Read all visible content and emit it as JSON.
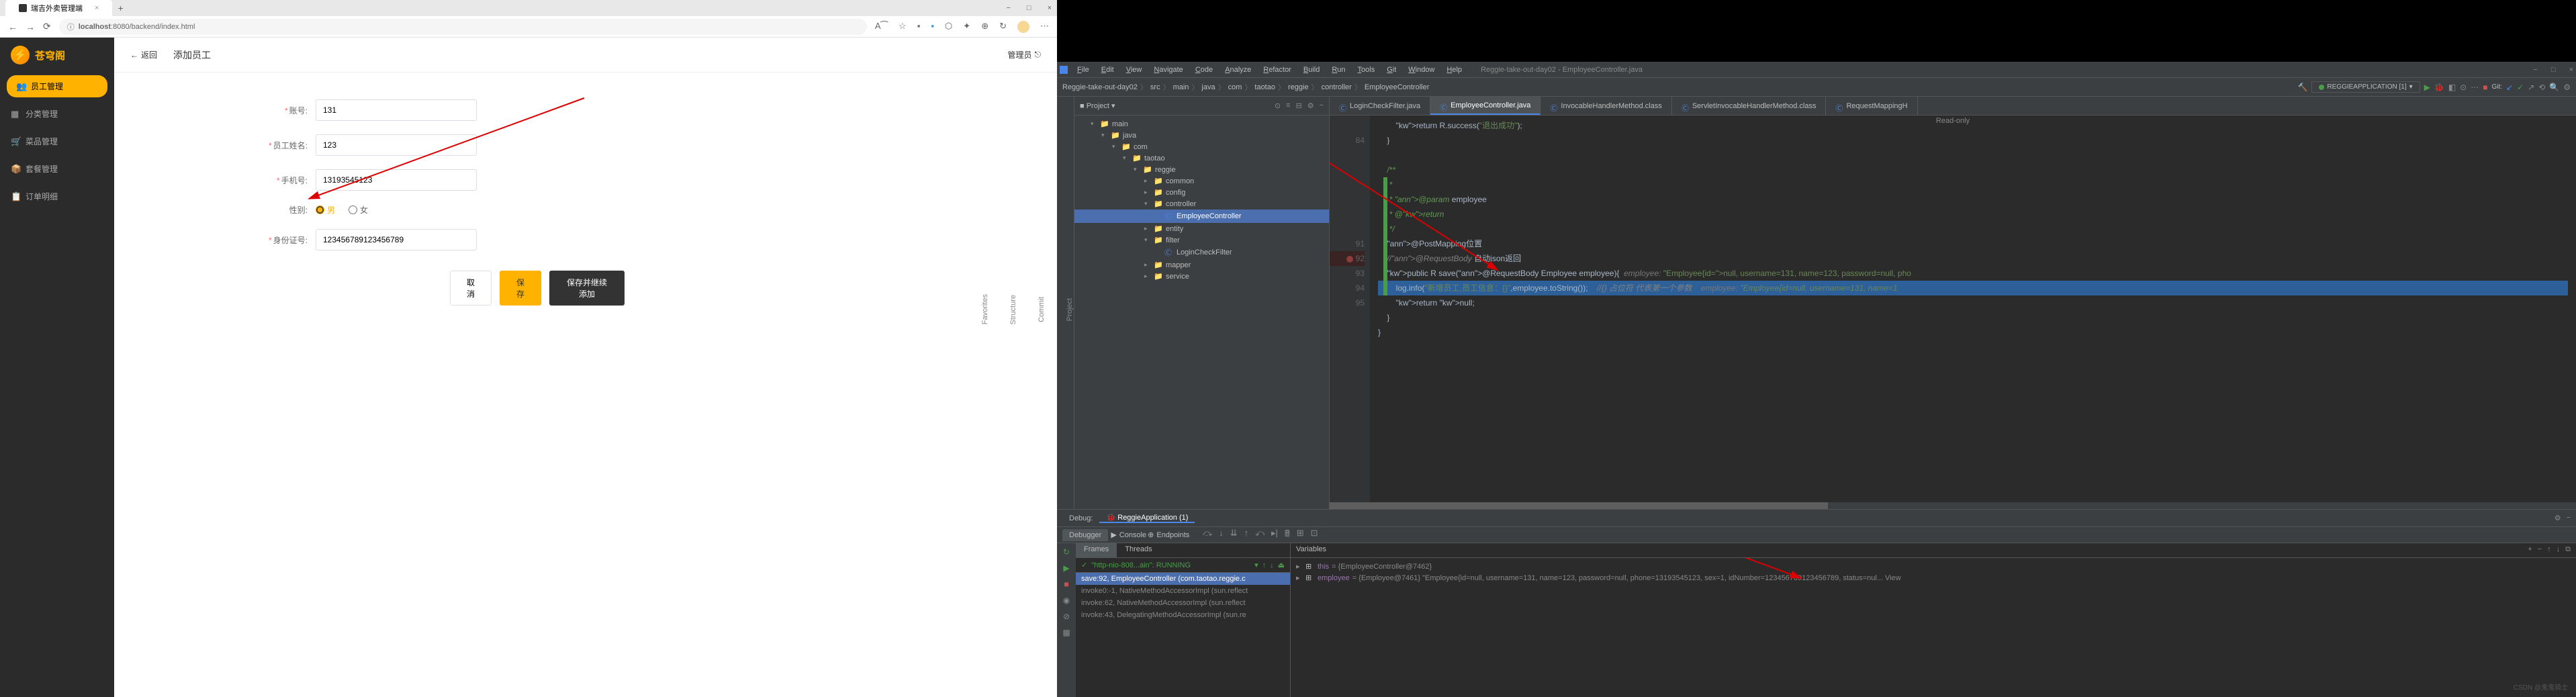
{
  "browser": {
    "tab_title": "瑞吉外卖管理端",
    "url_prefix": "localhost",
    "url": ":8080/backend/index.html",
    "window_controls": [
      "−",
      "□",
      "×"
    ]
  },
  "app": {
    "logo_text": "苍穹阁",
    "sidebar": [
      {
        "icon": "👥",
        "label": "员工管理",
        "active": true
      },
      {
        "icon": "▦",
        "label": "分类管理"
      },
      {
        "icon": "🛒",
        "label": "菜品管理"
      },
      {
        "icon": "📦",
        "label": "套餐管理"
      },
      {
        "icon": "📋",
        "label": "订单明细"
      }
    ],
    "back": "返回",
    "page_title": "添加员工",
    "header_user": "管理员",
    "form": {
      "account_label": "账号:",
      "account_value": "131",
      "name_label": "员工姓名:",
      "name_value": "123",
      "phone_label": "手机号:",
      "phone_value": "13193545123",
      "sex_label": "性别:",
      "sex_male": "男",
      "sex_female": "女",
      "id_label": "身份证号:",
      "id_value": "123456789123456789",
      "btn_cancel": "取消",
      "btn_save": "保存",
      "btn_save_continue": "保存并继续添加"
    }
  },
  "ide": {
    "menus": [
      "File",
      "Edit",
      "View",
      "Navigate",
      "Code",
      "Analyze",
      "Refactor",
      "Build",
      "Run",
      "Tools",
      "Git",
      "Window",
      "Help"
    ],
    "window_title": "Reggie-take-out-day02 - EmployeeController.java",
    "breadcrumb": [
      "Reggie-take-out-day02",
      "src",
      "main",
      "java",
      "com",
      "taotao",
      "reggie",
      "controller",
      "EmployeeController"
    ],
    "run_config": "REGGIEAPPLICATION [1]",
    "git_label": "Git:",
    "project_panel_title": "Project",
    "tree": [
      {
        "indent": 1,
        "arrow": "▾",
        "icon": "📁",
        "label": "main"
      },
      {
        "indent": 2,
        "arrow": "▾",
        "icon": "📁",
        "label": "java"
      },
      {
        "indent": 3,
        "arrow": "▾",
        "icon": "📁",
        "label": "com"
      },
      {
        "indent": 4,
        "arrow": "▾",
        "icon": "📁",
        "label": "taotao"
      },
      {
        "indent": 5,
        "arrow": "▾",
        "icon": "📁",
        "label": "reggie"
      },
      {
        "indent": 6,
        "arrow": "▸",
        "icon": "📁",
        "label": "common"
      },
      {
        "indent": 6,
        "arrow": "▸",
        "icon": "📁",
        "label": "config"
      },
      {
        "indent": 6,
        "arrow": "▾",
        "icon": "📁",
        "label": "controller"
      },
      {
        "indent": 7,
        "arrow": "",
        "icon": "Ⓒ",
        "label": "EmployeeController",
        "selected": true
      },
      {
        "indent": 6,
        "arrow": "▸",
        "icon": "📁",
        "label": "entity"
      },
      {
        "indent": 6,
        "arrow": "▾",
        "icon": "📁",
        "label": "filter"
      },
      {
        "indent": 7,
        "arrow": "",
        "icon": "Ⓒ",
        "label": "LoginCheckFilter"
      },
      {
        "indent": 6,
        "arrow": "▸",
        "icon": "📁",
        "label": "mapper"
      },
      {
        "indent": 6,
        "arrow": "▸",
        "icon": "📁",
        "label": "service"
      }
    ],
    "editor_tabs": [
      {
        "label": "LoginCheckFilter.java",
        "active": false
      },
      {
        "label": "EmployeeController.java",
        "active": true
      },
      {
        "label": "InvocableHandlerMethod.class",
        "active": false
      },
      {
        "label": "ServletInvocableHandlerMethod.class",
        "active": false
      },
      {
        "label": "RequestMappingH",
        "active": false
      }
    ],
    "readonly": "Read-only",
    "gutter_lines": [
      "",
      "84",
      "",
      "",
      "",
      "",
      "",
      "",
      "91",
      "92",
      "93",
      "94",
      "95"
    ],
    "code_lines": [
      "        return R.success(\"退出成功\");",
      "    }",
      "",
      "    /**",
      "     *",
      "     * @param employee",
      "     * @return",
      "     */",
      "    @PostMapping位置",
      "    //@RequestBody 自动json返回",
      "    public R<String> save(@RequestBody Employee employee){  employee: \"Employee{id=null, username=131, name=123, password=null, pho",
      "        log.info(\"新增员工,员工信息：{}\",employee.toString());    //{} 占位符 代表第一个参数    employee: \"Employee{id=null, username=131, name=1",
      "        return null;",
      "    }",
      "}"
    ],
    "debug": {
      "label": "Debug:",
      "config_tab": "ReggieApplication (1)",
      "subtabs": [
        "Debugger",
        "Console",
        "Endpoints"
      ],
      "frames_tab": "Frames",
      "threads_tab": "Threads",
      "thread_selector": "\"http-nio-808...ain\": RUNNING",
      "frames": [
        {
          "label": "save:92, EmployeeController (com.taotao.reggie.c",
          "active": true
        },
        {
          "label": "invoke0:-1, NativeMethodAccessorImpl (sun.reflect"
        },
        {
          "label": "invoke:62, NativeMethodAccessorImpl (sun.reflect"
        },
        {
          "label": "invoke:43, DelegatingMethodAccessorImpl (sun.re"
        }
      ],
      "variables_label": "Variables",
      "vars": [
        {
          "arrow": "▸",
          "name": "this",
          "value": "= {EmployeeController@7462}"
        },
        {
          "arrow": "▸",
          "name": "employee",
          "value": "= {Employee@7461} \"Employee{id=null, username=131, name=123, password=null, phone=13193545123, sex=1, idNumber=123456789123456789, status=nul...  View"
        }
      ]
    },
    "watermark": "CSDN @鬼鬼骑士"
  }
}
